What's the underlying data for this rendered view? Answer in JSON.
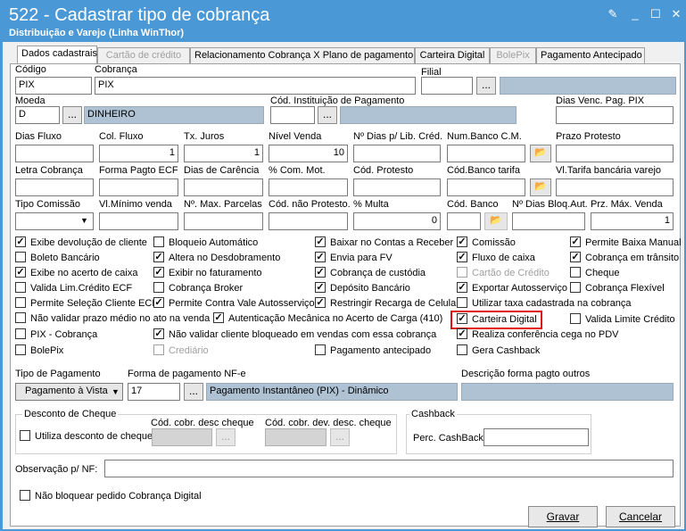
{
  "window": {
    "title": "522 - Cadastrar tipo de cobrança",
    "subtitle": "Distribuição e Varejo (Linha WinThor)",
    "accent": "#4a98d5"
  },
  "tabs": [
    "Dados cadastrais",
    "Cartão de crédito",
    "Relacionamento Cobrança X Plano de pagamento",
    "Carteira Digital",
    "BolePix",
    "Pagamento Antecipado"
  ],
  "fields": {
    "codigo_label": "Código",
    "codigo": "PIX",
    "cobranca_label": "Cobrança",
    "cobranca": "PIX",
    "filial_label": "Filial",
    "filial": "",
    "moeda_label": "Moeda",
    "moeda": "D",
    "moeda_desc": "DINHEIRO",
    "cod_inst_label": "Cód. Instituição de Pagamento",
    "cod_inst": "",
    "dias_venc_label": "Dias Venc. Pag. PIX",
    "dias_venc": "",
    "dias_fluxo_label": "Dias Fluxo",
    "dias_fluxo": "",
    "col_fluxo_label": "Col. Fluxo",
    "col_fluxo": "1",
    "tx_juros_label": "Tx. Juros",
    "tx_juros": "1",
    "nivel_venda_label": "Nível Venda",
    "nivel_venda": "10",
    "n_dias_lib_label": "Nº Dias p/ Lib. Créd.",
    "n_dias_lib": "",
    "num_banco_label": "Num.Banco C.M.",
    "num_banco": "",
    "prazo_protesto_label": "Prazo Protesto",
    "prazo_protesto": "",
    "letra_cobranca_label": "Letra Cobrança",
    "letra_cobranca": "",
    "forma_pagto_ecf_label": "Forma Pagto ECF",
    "forma_pagto_ecf": "",
    "dias_carencia_label": "Dias de Carência",
    "dias_carencia": "",
    "com_mot_label": "% Com. Mot.",
    "com_mot": "",
    "cod_protesto_label": "Cód. Protesto",
    "cod_protesto": "",
    "cod_banco_tarifa_label": "Cód.Banco tarifa",
    "cod_banco_tarifa": "",
    "vl_tarifa_label": "Vl.Tarifa bancária varejo",
    "vl_tarifa": "",
    "tipo_comissao_label": "Tipo Comissão",
    "tipo_comissao": "",
    "vl_minimo_label": "Vl.Mínimo venda",
    "vl_minimo": "",
    "max_parcelas_label": "Nº. Max. Parcelas",
    "max_parcelas": "",
    "cod_nao_protesto_label": "Cód. não Protesto.",
    "cod_nao_protesto": "",
    "multa_label": "% Multa",
    "multa": "0",
    "cod_banco_label": "Cód. Banco",
    "cod_banco": "",
    "dias_bloq_label": "Nº Dias Bloq.Aut.",
    "dias_bloq": "",
    "prz_max_label": "Prz. Máx. Venda",
    "prz_max": "1"
  },
  "checkboxes": [
    {
      "label": "Exibe devolução de cliente",
      "checked": true,
      "disabled": false
    },
    {
      "label": "Boleto Bancário",
      "checked": false,
      "disabled": false
    },
    {
      "label": "Exibe no acerto de caixa",
      "checked": true,
      "disabled": false
    },
    {
      "label": "Valida Lim.Crédito ECF",
      "checked": false,
      "disabled": false
    },
    {
      "label": "Permite Seleção Cliente ECF",
      "checked": false,
      "disabled": false
    },
    {
      "label": "Não validar prazo médio no ato na venda",
      "checked": false,
      "disabled": false
    },
    {
      "label": "PIX - Cobrança",
      "checked": false,
      "disabled": false
    },
    {
      "label": "BolePix",
      "checked": false,
      "disabled": false
    },
    {
      "label": "Bloqueio Automático",
      "checked": false,
      "disabled": false
    },
    {
      "label": "Altera no Desdobramento",
      "checked": true,
      "disabled": false
    },
    {
      "label": "Exibir no faturamento",
      "checked": true,
      "disabled": false
    },
    {
      "label": "Cobrança Broker",
      "checked": false,
      "disabled": false
    },
    {
      "label": "Permite Contra Vale Autosserviço",
      "checked": true,
      "disabled": false
    },
    {
      "label": "Autenticação Mecânica no Acerto de Carga (410)",
      "checked": true,
      "disabled": false
    },
    {
      "label": "Não validar cliente bloqueado em vendas com essa cobrança",
      "checked": true,
      "disabled": false
    },
    {
      "label": "Crediário",
      "checked": false,
      "disabled": true
    },
    {
      "label": "Baixar no Contas a Receber",
      "checked": true,
      "disabled": false
    },
    {
      "label": "Envia para FV",
      "checked": true,
      "disabled": false
    },
    {
      "label": "Cobrança de custódia",
      "checked": true,
      "disabled": false
    },
    {
      "label": "Depósito Bancário",
      "checked": true,
      "disabled": false
    },
    {
      "label": "Restringir Recarga de Celular",
      "checked": true,
      "disabled": false
    },
    {
      "label": "Pagamento antecipado",
      "checked": false,
      "disabled": false
    },
    {
      "label": "Comissão",
      "checked": true,
      "disabled": false
    },
    {
      "label": "Fluxo de caixa",
      "checked": true,
      "disabled": false
    },
    {
      "label": "Cartão de Crédito",
      "checked": false,
      "disabled": true
    },
    {
      "label": "Exportar Autosserviço",
      "checked": true,
      "disabled": false
    },
    {
      "label": "Utilizar taxa cadastrada na cobrança",
      "checked": false,
      "disabled": false
    },
    {
      "label": "Carteira Digital",
      "checked": true,
      "disabled": false
    },
    {
      "label": "Realiza conferência cega no PDV",
      "checked": true,
      "disabled": false
    },
    {
      "label": "Gera Cashback",
      "checked": false,
      "disabled": false
    },
    {
      "label": "Permite Baixa Manual",
      "checked": true,
      "disabled": false
    },
    {
      "label": "Cobrança em trânsito",
      "checked": true,
      "disabled": false
    },
    {
      "label": "Cheque",
      "checked": false,
      "disabled": false
    },
    {
      "label": "Cobrança Flexível",
      "checked": false,
      "disabled": false
    },
    {
      "label": "Valida Limite Crédito",
      "checked": false,
      "disabled": false
    }
  ],
  "pagamento": {
    "tipo_label": "Tipo de Pagamento",
    "tipo": "Pagamento à Vista",
    "forma_label": "Forma de pagamento NF-e",
    "forma_cod": "17",
    "forma_desc": "Pagamento Instantâneo (PIX) - Dinâmico",
    "desc_outros_label": "Descrição forma pagto outros",
    "desc_outros": ""
  },
  "cheque_group": {
    "title": "Desconto de Cheque",
    "utiliza": "Utiliza desconto de cheque",
    "cod_desc_label": "Cód. cobr. desc cheque",
    "cod_dev_label": "Cód. cobr. dev. desc. cheque"
  },
  "cashback": {
    "title": "Cashback",
    "perc_label": "Perc. CashBack",
    "perc": ""
  },
  "observacao_label": "Observação p/ NF:",
  "observacao": "",
  "nao_bloquear": "Não bloquear pedido Cobrança Digital",
  "buttons": {
    "gravar": "Gravar",
    "cancelar": "Cancelar",
    "ellipsis": "..."
  }
}
